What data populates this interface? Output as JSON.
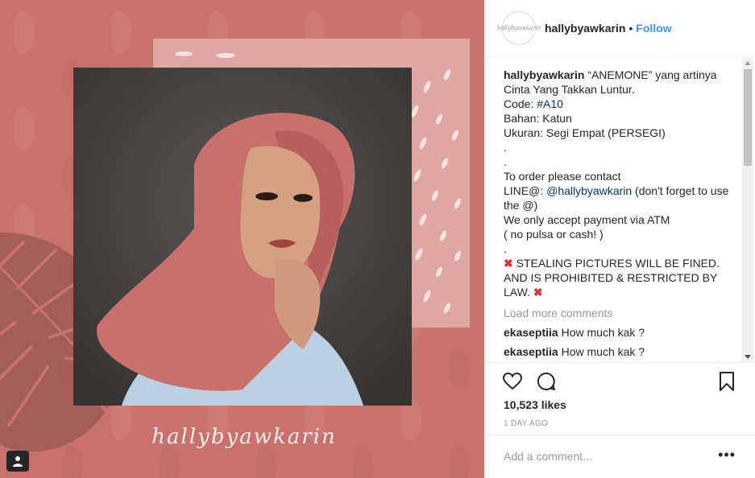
{
  "post": {
    "username": "hallybyawkarin",
    "separator": "•",
    "follow_label": "Follow",
    "avatar_text": "hallybyawkarin",
    "signature_text": "hallybyawkarin"
  },
  "caption": {
    "username": "hallybyawkarin",
    "line1_text": "“ANEMONE” yang artinya",
    "line2": "Cinta Yang Takkan Luntur.",
    "code_prefix": "Code: ",
    "code_tag": "#A10",
    "line_bahan": "Bahan: Katun",
    "line_ukuran": "Ukuran: Segi Empat (PERSEGI)",
    "dot1": ".",
    "dot2": ".",
    "line_order": "To order please contact",
    "line_line_prefix": "LINE@: ",
    "line_mention": "@hallybyawkarin",
    "line_line_suffix": " (don't forget to use the @)",
    "line_payment": "We only accept payment via ATM",
    "line_no_pulsa": "( no pulsa or cash! )",
    "dot3": ".",
    "warning_1": " STEALING PICTURES WILL BE FINED. AND IS PROHIBITED & RESTRICTED BY LAW. ",
    "x_mark": "✖"
  },
  "load_more": "Load more comments",
  "comments": [
    {
      "user": "ekaseptiia",
      "text": "How much kak ?"
    },
    {
      "user": "ekaseptiia",
      "text": "How much kak ?"
    }
  ],
  "likes": "10,523 likes",
  "time_ago": "1 DAY AGO",
  "add_comment_placeholder": "Add a comment...",
  "more_options": "•••",
  "colors": {
    "accent": "#3897f0",
    "media_bg": "#c9726b",
    "back_card": "#dfa6a3"
  }
}
